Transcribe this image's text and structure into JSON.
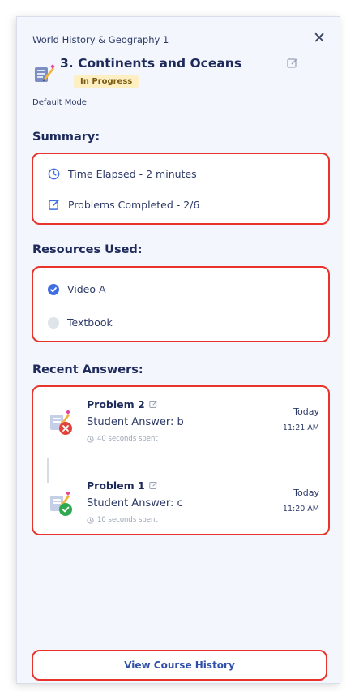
{
  "header": {
    "course": "World History & Geography 1",
    "lesson_title": "3. Continents and Oceans",
    "status": "In Progress",
    "mode": "Default Mode"
  },
  "summary": {
    "heading": "Summary:",
    "time_elapsed": "Time Elapsed - 2 minutes",
    "problems_completed": "Problems Completed - 2/6"
  },
  "resources": {
    "heading": "Resources Used:",
    "items": [
      {
        "label": "Video A",
        "used": true
      },
      {
        "label": "Textbook",
        "used": false
      }
    ]
  },
  "recent": {
    "heading": "Recent Answers:",
    "answers": [
      {
        "title": "Problem 2",
        "answer": "Student Answer: b",
        "spent": "40 seconds spent",
        "day": "Today",
        "time": "11:21 AM",
        "correct": false
      },
      {
        "title": "Problem 1",
        "answer": "Student Answer: c",
        "spent": "10 seconds spent",
        "day": "Today",
        "time": "11:20 AM",
        "correct": true
      }
    ]
  },
  "footer": {
    "history_button": "View Course History"
  },
  "colors": {
    "accent": "#3f6ee0",
    "highlight_border": "#e8322c",
    "badge_bg": "#fdefc2",
    "wrong": "#e2423b",
    "correct": "#2fa84f"
  },
  "icons": [
    "lesson-icon",
    "edit-icon",
    "close-icon",
    "clock-icon",
    "problems-icon",
    "check-icon",
    "x-icon"
  ]
}
